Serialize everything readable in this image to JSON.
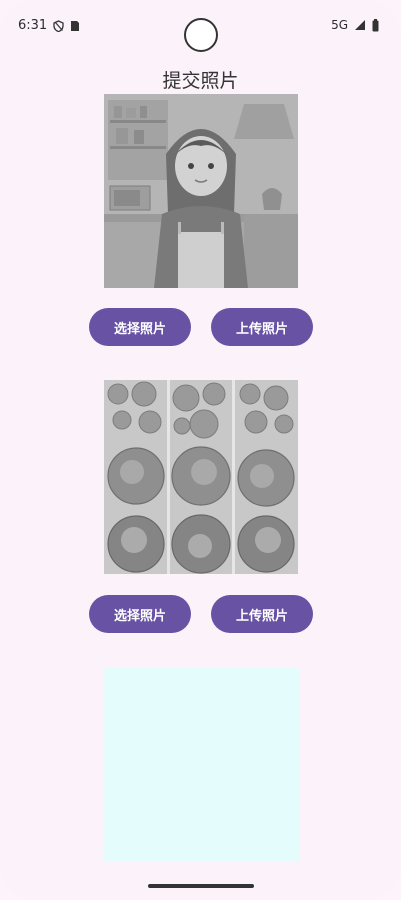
{
  "status_bar": {
    "time": "6:31",
    "network": "5G"
  },
  "page": {
    "title": "提交照片"
  },
  "section1": {
    "select_label": "选择照片",
    "upload_label": "上传照片"
  },
  "section2": {
    "select_label": "选择照片",
    "upload_label": "上传照片"
  },
  "colors": {
    "button": "#6852a4",
    "background": "#fcf3fa",
    "empty_box": "#e4fcfc"
  }
}
